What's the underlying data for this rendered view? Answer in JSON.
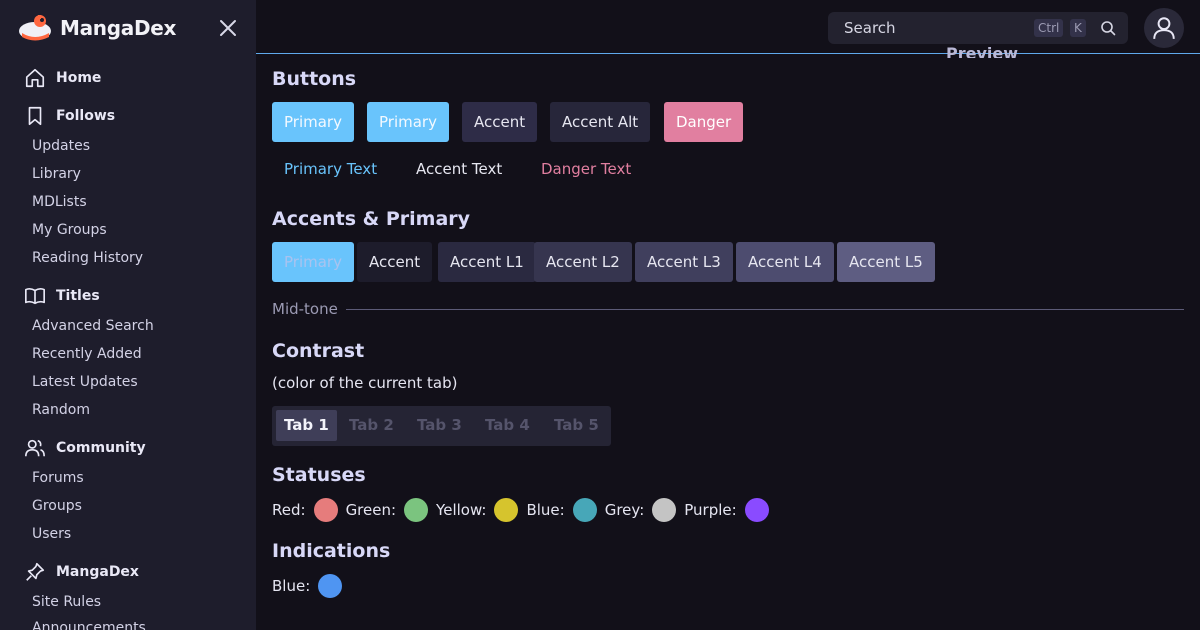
{
  "brand": {
    "name": "MangaDex"
  },
  "sidebar": {
    "sections": [
      {
        "label": "Home",
        "icon": "home-icon"
      },
      {
        "label": "Follows",
        "icon": "bookmark-icon",
        "items": [
          "Updates",
          "Library",
          "MDLists",
          "My Groups",
          "Reading History"
        ]
      },
      {
        "label": "Titles",
        "icon": "book-open-icon",
        "items": [
          "Advanced Search",
          "Recently Added",
          "Latest Updates",
          "Random"
        ]
      },
      {
        "label": "Community",
        "icon": "users-icon",
        "items": [
          "Forums",
          "Groups",
          "Users"
        ]
      },
      {
        "label": "MangaDex",
        "icon": "pin-icon",
        "items": [
          "Site Rules",
          "Announcements"
        ]
      }
    ]
  },
  "header": {
    "search": {
      "placeholder": "Search",
      "kbd_ctrl": "Ctrl",
      "kbd_key": "K"
    },
    "ghost_title": "Preview"
  },
  "main": {
    "buttons": {
      "title": "Buttons",
      "filled": [
        "Primary",
        "Primary",
        "Accent",
        "Accent Alt",
        "Danger"
      ],
      "text": [
        "Primary Text",
        "Accent Text",
        "Danger Text"
      ]
    },
    "accents": {
      "title": "Accents & Primary",
      "items": [
        "Primary",
        "Accent",
        "Accent L1",
        "Accent L2",
        "Accent L3",
        "Accent L4",
        "Accent L5"
      ]
    },
    "midtone": "Mid-tone",
    "contrast": {
      "title": "Contrast",
      "note": "(color of the current tab)",
      "tabs": [
        "Tab 1",
        "Tab 2",
        "Tab 3",
        "Tab 4",
        "Tab 5"
      ]
    },
    "statuses": {
      "title": "Statuses",
      "items": [
        {
          "label": "Red:",
          "color": "#e67c7c"
        },
        {
          "label": "Green:",
          "color": "#7bc47f"
        },
        {
          "label": "Yellow:",
          "color": "#d6c42d"
        },
        {
          "label": "Blue:",
          "color": "#47a7b8"
        },
        {
          "label": "Grey:",
          "color": "#c4c4c4"
        },
        {
          "label": "Purple:",
          "color": "#8a4bff"
        }
      ]
    },
    "indications": {
      "title": "Indications",
      "items": [
        {
          "label": "Blue:",
          "color": "#4f95f2"
        }
      ]
    }
  },
  "colors": {
    "primary": "#69c4fc",
    "accent": "#2e2c47",
    "accent_alt": "#27263a",
    "danger": "#e17fa0"
  }
}
